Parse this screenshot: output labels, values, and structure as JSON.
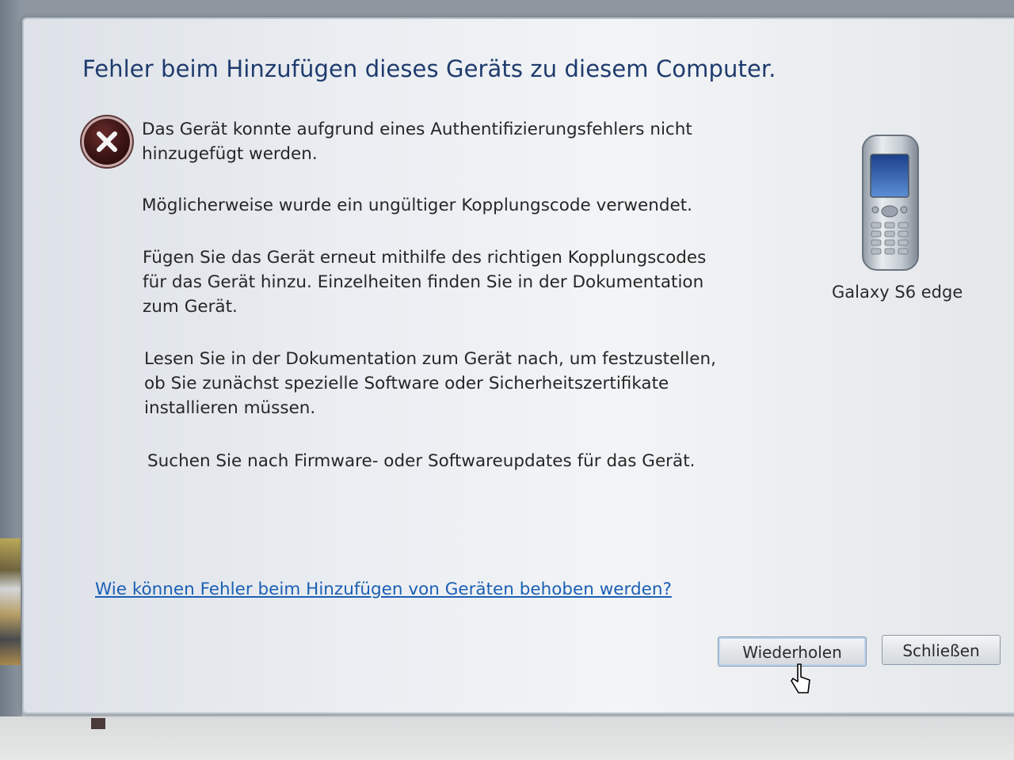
{
  "dialog": {
    "title": "Fehler beim Hinzufügen dieses Geräts zu diesem Computer.",
    "paragraphs": [
      [
        "Das Gerät konnte aufgrund eines Authentifizierungsfehlers nicht",
        "hinzugefügt werden."
      ],
      [
        "Möglicherweise wurde ein ungültiger Kopplungscode verwendet."
      ],
      [
        "Fügen Sie das Gerät erneut mithilfe des richtigen Kopplungscodes",
        "für das Gerät hinzu. Einzelheiten finden Sie in der Dokumentation",
        "zum Gerät."
      ],
      [
        "Lesen Sie in der Dokumentation zum Gerät nach, um festzustellen,",
        "ob Sie zunächst spezielle Software oder Sicherheitszertifikate",
        "installieren müssen."
      ],
      [
        "Suchen Sie nach Firmware- oder Softwareupdates für das Gerät."
      ]
    ],
    "device_name": "Galaxy S6 edge",
    "help_link": "Wie können Fehler beim Hinzufügen von Geräten behoben werden?",
    "buttons": {
      "retry": "Wiederholen",
      "close": "Schließen"
    },
    "icons": {
      "error": "error-x-icon",
      "device": "mobile-phone-icon",
      "cursor": "mouse-pointer-icon"
    },
    "colors": {
      "title": "#1f3b6e",
      "link": "#1a5fb4",
      "error_icon": "#3a1414"
    }
  }
}
